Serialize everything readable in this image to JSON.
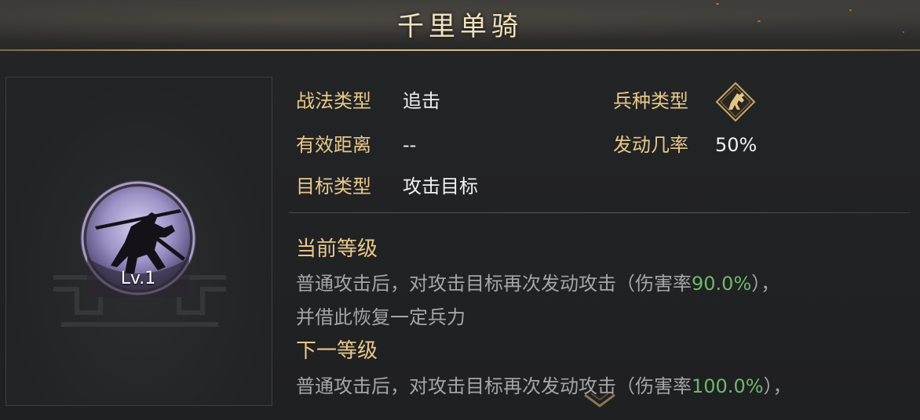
{
  "title": "千里单骑",
  "skill_icon": {
    "name": "horseman-silhouette-icon",
    "level": "Lv.1"
  },
  "info": {
    "tactic_type_label": "战法类型",
    "tactic_type_value": "追击",
    "troop_type_label": "兵种类型",
    "troop_type_icon": "cavalry-horse-icon",
    "range_label": "有效距离",
    "range_value": "--",
    "trigger_rate_label": "发动几率",
    "trigger_rate_value": "50%",
    "target_type_label": "目标类型",
    "target_type_value": "攻击目标"
  },
  "current_level": {
    "title": "当前等级",
    "line1_prefix": "普通攻击后，对攻击目标再次发动攻击（伤害率",
    "line1_rate": "90.0%",
    "line1_suffix": "），",
    "line2": "并借此恢复一定兵力"
  },
  "next_level": {
    "title": "下一等级",
    "line1_prefix": "普通攻击后，对攻击目标再次发动攻击（伤害率",
    "line1_rate": "100.0%",
    "line1_suffix": "），"
  },
  "colors": {
    "gold_label": "#e9c98a",
    "value_white": "#f1f1f1",
    "desc_grey": "#a6a6a6",
    "rate_green": "#6fb86c",
    "emblem_purple": "#8a7fb6"
  }
}
